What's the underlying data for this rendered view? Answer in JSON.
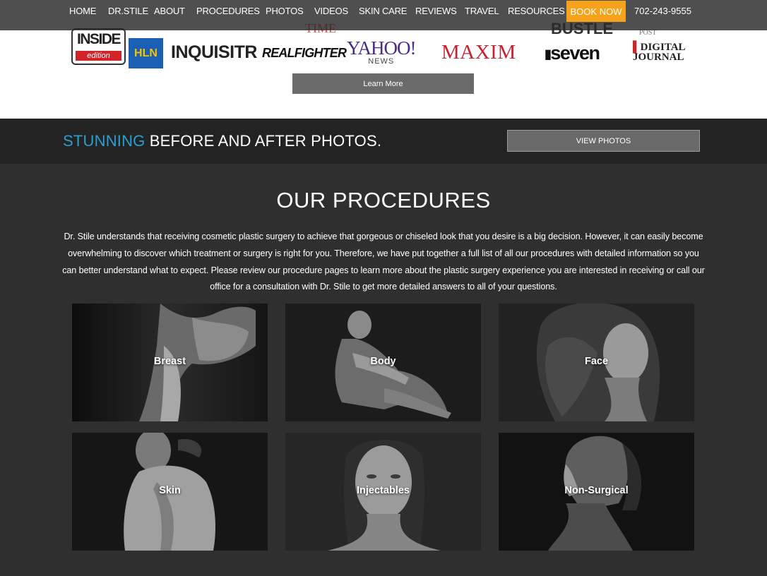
{
  "nav": {
    "items": [
      "HOME",
      "DR.STILE",
      "ABOUT",
      "PROCEDURES",
      "PHOTOS",
      "VIDEOS",
      "SKIN CARE",
      "REVIEWS",
      "TRAVEL",
      "RESOURCES"
    ],
    "book_label": "BOOK NOW",
    "phone": "702-243-9555",
    "book_color": "#f7a21b"
  },
  "press": {
    "logos": {
      "inside_edition": [
        "INSIDE",
        "edition"
      ],
      "hln": "HLN",
      "inquisitr": "INQUISITR",
      "realfighter": "REALFIGHTER",
      "yahoo": [
        "YAHOO!",
        "NEWS"
      ],
      "maxim": "MAXIM",
      "seven": "seven",
      "digital_journal": [
        "DIGITAL",
        "JOURNAL"
      ],
      "ghost_top": [
        "TIME",
        "BUSTLE",
        "POST"
      ]
    },
    "learn_more_label": "Learn More"
  },
  "band": {
    "accent_word": "STUNNING",
    "rest": " BEFORE AND AFTER PHOTOS.",
    "accent_color": "#2a9fd0",
    "button_label": "VIEW PHOTOS"
  },
  "procedures": {
    "title": "OUR PROCEDURES",
    "description": "Dr. Stile understands that receiving cosmetic plastic surgery to achieve that gorgeous or chiseled look that you desire is a big decision. However, it can easily become overwhelming to discover which treatment or surgery is right for you. Therefore, we have put together a full list of all our procedures with detailed information so you can better understand what to expect. Please review our procedure pages to learn more about the plastic surgery experience you are interested in receiving or call our office for a consultation with Dr. Stile to get more detailed answers to all of your questions.",
    "tiles": [
      "Breast",
      "Body",
      "Face",
      "Skin",
      "Injectables",
      "Non-Surgical"
    ]
  }
}
